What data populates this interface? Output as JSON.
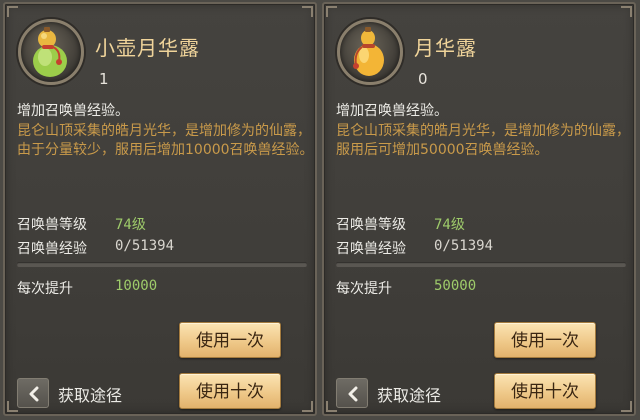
{
  "panels": [
    {
      "item_name": "小壶月华露",
      "item_count": "1",
      "desc_title": "增加召唤兽经验。",
      "desc_body": "昆仑山顶采集的皓月光华，是增加修为的仙露，由于分量较少，服用后增加10000召唤兽经验。",
      "pet_level_label": "召唤兽等级",
      "pet_level_value": "74级",
      "pet_exp_label": "召唤兽经验",
      "pet_exp_value": "0/51394",
      "exp_progress": 0,
      "gain_label": "每次提升",
      "gain_value": "10000",
      "use_once_label": "使用一次",
      "use_ten_label": "使用十次",
      "source_label": "获取途径",
      "icon": "gourd-icon"
    },
    {
      "item_name": "月华露",
      "item_count": "0",
      "desc_title": "增加召唤兽经验。",
      "desc_body": "昆仑山顶采集的皓月光华，是增加修为的仙露，服用后可增加50000召唤兽经验。",
      "pet_level_label": "召唤兽等级",
      "pet_level_value": "74级",
      "pet_exp_label": "召唤兽经验",
      "pet_exp_value": "0/51394",
      "exp_progress": 0,
      "gain_label": "每次提升",
      "gain_value": "50000",
      "use_once_label": "使用一次",
      "use_ten_label": "使用十次",
      "source_label": "获取途径",
      "icon": "gourd-icon"
    }
  ],
  "colors": {
    "item_name": "#f0d49a",
    "description": "#c99a4a",
    "value_green": "#9ecb6a",
    "button": "#efc98a"
  }
}
